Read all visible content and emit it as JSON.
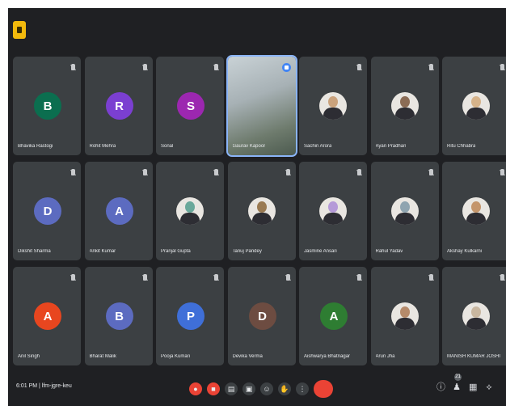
{
  "meeting": {
    "time_code": "6:01 PM  |  lfm-jgre-keu"
  },
  "participants": [
    {
      "name": "Bhavika Rastogi",
      "initial": "B",
      "color": "#0b6e4f",
      "kind": "initial"
    },
    {
      "name": "Rohit Mehra",
      "initial": "R",
      "color": "#7b3fd1",
      "kind": "initial"
    },
    {
      "name": "Sonal",
      "initial": "S",
      "color": "#9c27b0",
      "kind": "initial"
    },
    {
      "name": "Gaurav Kapoor",
      "initial": "",
      "color": "",
      "kind": "video"
    },
    {
      "name": "Sachin Arora",
      "initial": "",
      "color": "#caa27c",
      "kind": "photo"
    },
    {
      "name": "Ayan Pradhan",
      "initial": "",
      "color": "#8b6c55",
      "kind": "photo"
    },
    {
      "name": "Ritu Chhabra",
      "initial": "",
      "color": "#d6b38a",
      "kind": "photo"
    },
    {
      "name": "Dikshit Sharma",
      "initial": "D",
      "color": "#5c6bc0",
      "kind": "initial"
    },
    {
      "name": "Ankit Kumar",
      "initial": "A",
      "color": "#5c6bc0",
      "kind": "initial"
    },
    {
      "name": "Pranjal Gupta",
      "initial": "",
      "color": "#6aa89a",
      "kind": "photo"
    },
    {
      "name": "Tanuj Pandey",
      "initial": "",
      "color": "#9a7a52",
      "kind": "photo"
    },
    {
      "name": "Jasmine Ansari",
      "initial": "",
      "color": "#b59ad8",
      "kind": "photo"
    },
    {
      "name": "Rahul Yadav",
      "initial": "",
      "color": "#8fa4b0",
      "kind": "photo"
    },
    {
      "name": "Akshay Kulkarni",
      "initial": "",
      "color": "#c4956b",
      "kind": "photo"
    },
    {
      "name": "Anil Singh",
      "initial": "A",
      "color": "#e8461f",
      "kind": "initial"
    },
    {
      "name": "Bharat Malik",
      "initial": "B",
      "color": "#5c6bc0",
      "kind": "initial"
    },
    {
      "name": "Pooja Kumari",
      "initial": "P",
      "color": "#3f6fd8",
      "kind": "initial"
    },
    {
      "name": "Devika Verma",
      "initial": "D",
      "color": "#6d4c41",
      "kind": "initial"
    },
    {
      "name": "Aishwarya Bhatnagar",
      "initial": "A",
      "color": "#2e7d32",
      "kind": "initial"
    },
    {
      "name": "Arun Jha",
      "initial": "",
      "color": "#b58a6a",
      "kind": "photo"
    },
    {
      "name": "MANISH KUMAR JOSHI",
      "initial": "",
      "color": "#c9b7a0",
      "kind": "photo"
    }
  ],
  "toolbar": {
    "mic_icon": "mic-off-icon",
    "camera_icon": "camera-off-icon",
    "captions_icon": "captions-icon",
    "present_icon": "present-icon",
    "reactions_icon": "emoji-icon",
    "hand_icon": "raise-hand-icon",
    "more_icon": "more-icon",
    "end_icon": "end-call-icon",
    "accent_red": "#ea4335"
  },
  "right_panel": {
    "participant_count": "21"
  }
}
